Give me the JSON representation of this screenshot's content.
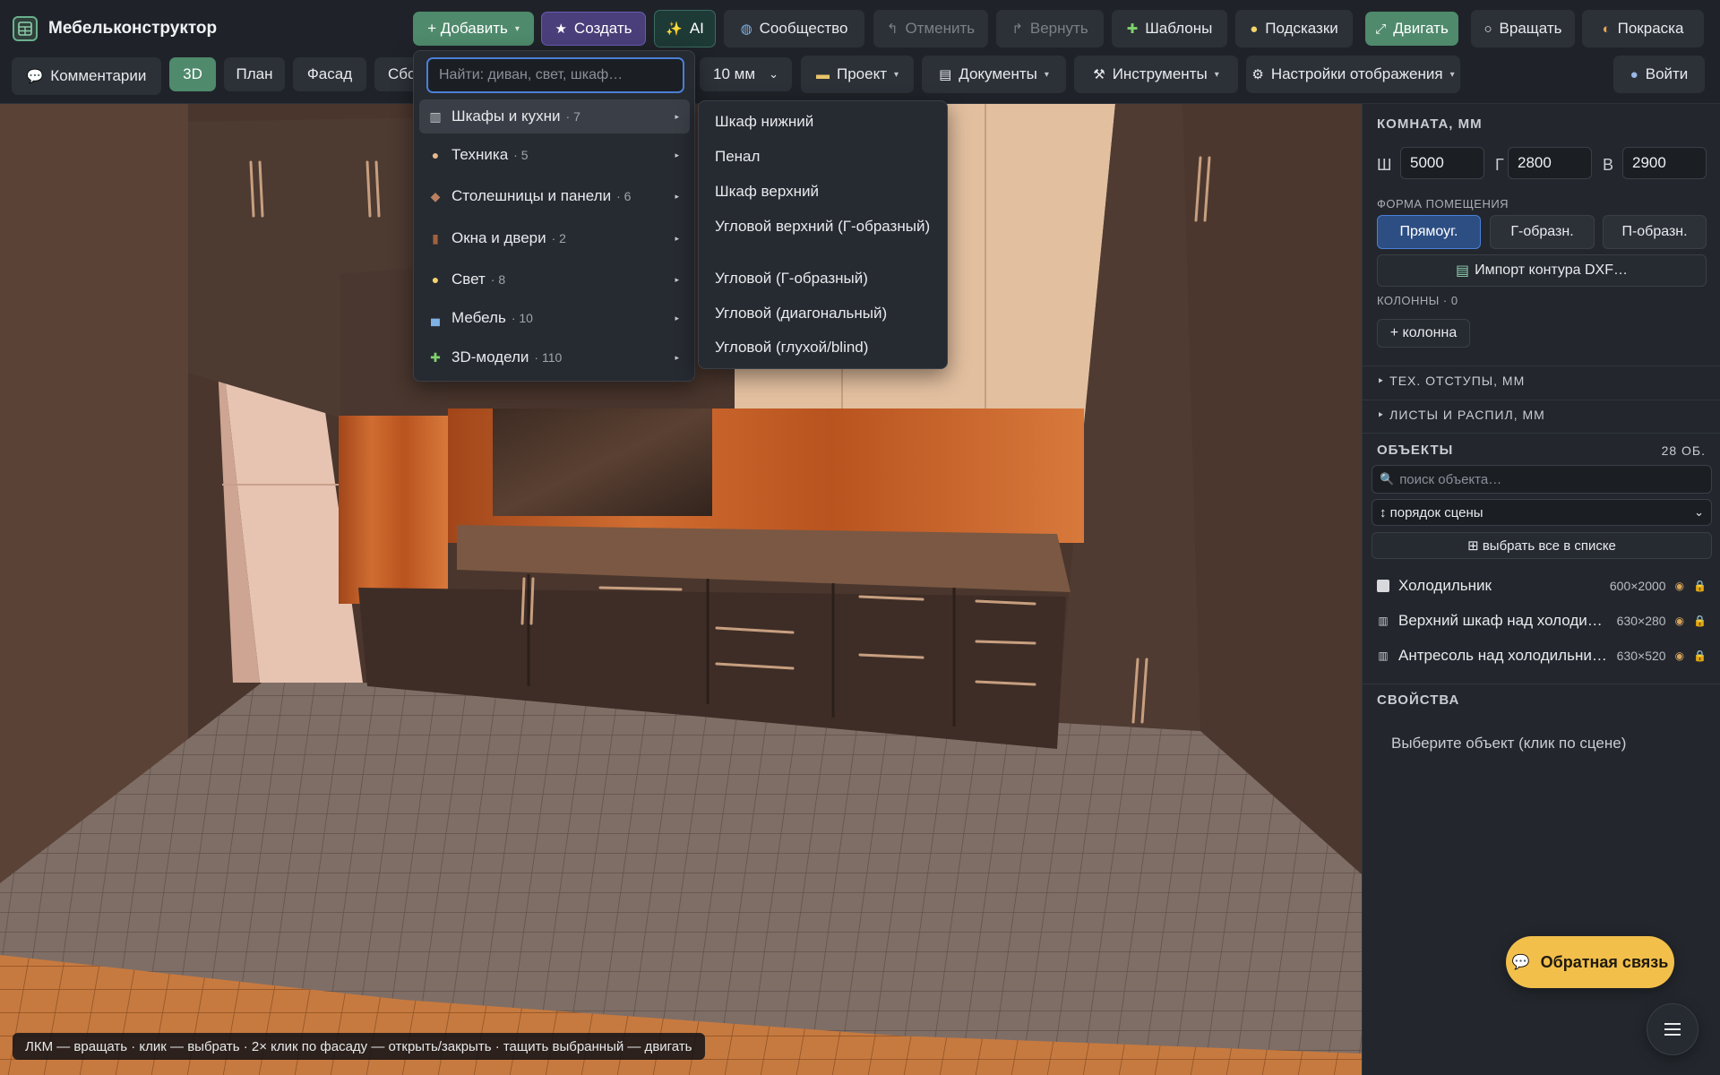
{
  "app": {
    "title": "Мебельконструктор"
  },
  "toolbar": {
    "add": "+ Добавить",
    "create": "Создать",
    "ai": "AI",
    "community": "Сообщество",
    "undo": "Отменить",
    "redo": "Вернуть",
    "templates": "Шаблоны",
    "hints": "Подсказки",
    "move": "Двигать",
    "rotate": "Вращать",
    "paint": "Покраска",
    "comments": "Комментарии",
    "view_3d": "3D",
    "view_plan": "План",
    "view_facade": "Фасад",
    "view_assembly_partial": "Сбо",
    "step": "10 мм",
    "project": "Проект",
    "documents": "Документы",
    "tools": "Инструменты",
    "display_settings": "Настройки отображения",
    "login": "Войти"
  },
  "add_menu": {
    "search_placeholder": "Найти: диван, свет, шкаф…",
    "categories": [
      {
        "label": "Шкафы и кухни",
        "count": "· 7",
        "icon": "cabinet-icon"
      },
      {
        "label": "Техника",
        "count": "· 5",
        "icon": "appliance-icon"
      },
      {
        "label": "Столешницы и панели",
        "count": "· 6",
        "icon": "countertop-icon"
      },
      {
        "label": "Окна и двери",
        "count": "· 2",
        "icon": "door-icon"
      },
      {
        "label": "Свет",
        "count": "· 8",
        "icon": "lightbulb-icon"
      },
      {
        "label": "Мебель",
        "count": "· 10",
        "icon": "sofa-icon"
      },
      {
        "label": "3D-модели",
        "count": "· 110",
        "icon": "puzzle-icon"
      }
    ],
    "submenu": [
      "Шкаф нижний",
      "Пенал",
      "Шкаф верхний",
      "Угловой верхний (Г-образный)",
      "Угловой (Г-образный)",
      "Угловой (диагональный)",
      "Угловой (глухой/blind)"
    ]
  },
  "panel": {
    "room_title": "КОМНАТА, ММ",
    "width_label": "Ш",
    "width": "5000",
    "depth_label": "Г",
    "depth": "2800",
    "height_label": "В",
    "height": "2900",
    "shape_title": "ФОРМА ПОМЕЩЕНИЯ",
    "shape_rect": "Прямоуг.",
    "shape_l": "Г-образн.",
    "shape_u": "П-образн.",
    "import_dxf": "Импорт контура DXF…",
    "columns_title": "КОЛОННЫ · 0",
    "add_column": "+ колонна",
    "tech_offsets": "ТЕХ. ОТСТУПЫ, ММ",
    "sheets": "ЛИСТЫ И РАСПИЛ, ММ",
    "objects_title": "ОБЪЕКТЫ",
    "objects_count": "28 ОБ.",
    "object_search_placeholder": "поиск объекта…",
    "sort_order": "↕ порядок сцены",
    "select_all": "⊞ выбрать все в списке",
    "objects": [
      {
        "name": "Холодильник",
        "size": "600×2000"
      },
      {
        "name": "Верхний шкаф над холодильником",
        "size": "630×280"
      },
      {
        "name": "Антресоль над холодильником",
        "size": "630×520"
      }
    ],
    "properties_title": "СВОЙСТВА",
    "properties_empty": "Выберите объект (клик по сцене)"
  },
  "scene": {
    "hint": "ЛКМ — вращать · клик — выбрать · 2× клик по фасаду — открыть/закрыть · тащить выбранный — двигать"
  },
  "feedback": "Обратная связь",
  "colors": {
    "accent_green": "#4f8a6c",
    "accent_blue": "#4a7fd6",
    "feedback_yellow": "#f2bf4b"
  }
}
